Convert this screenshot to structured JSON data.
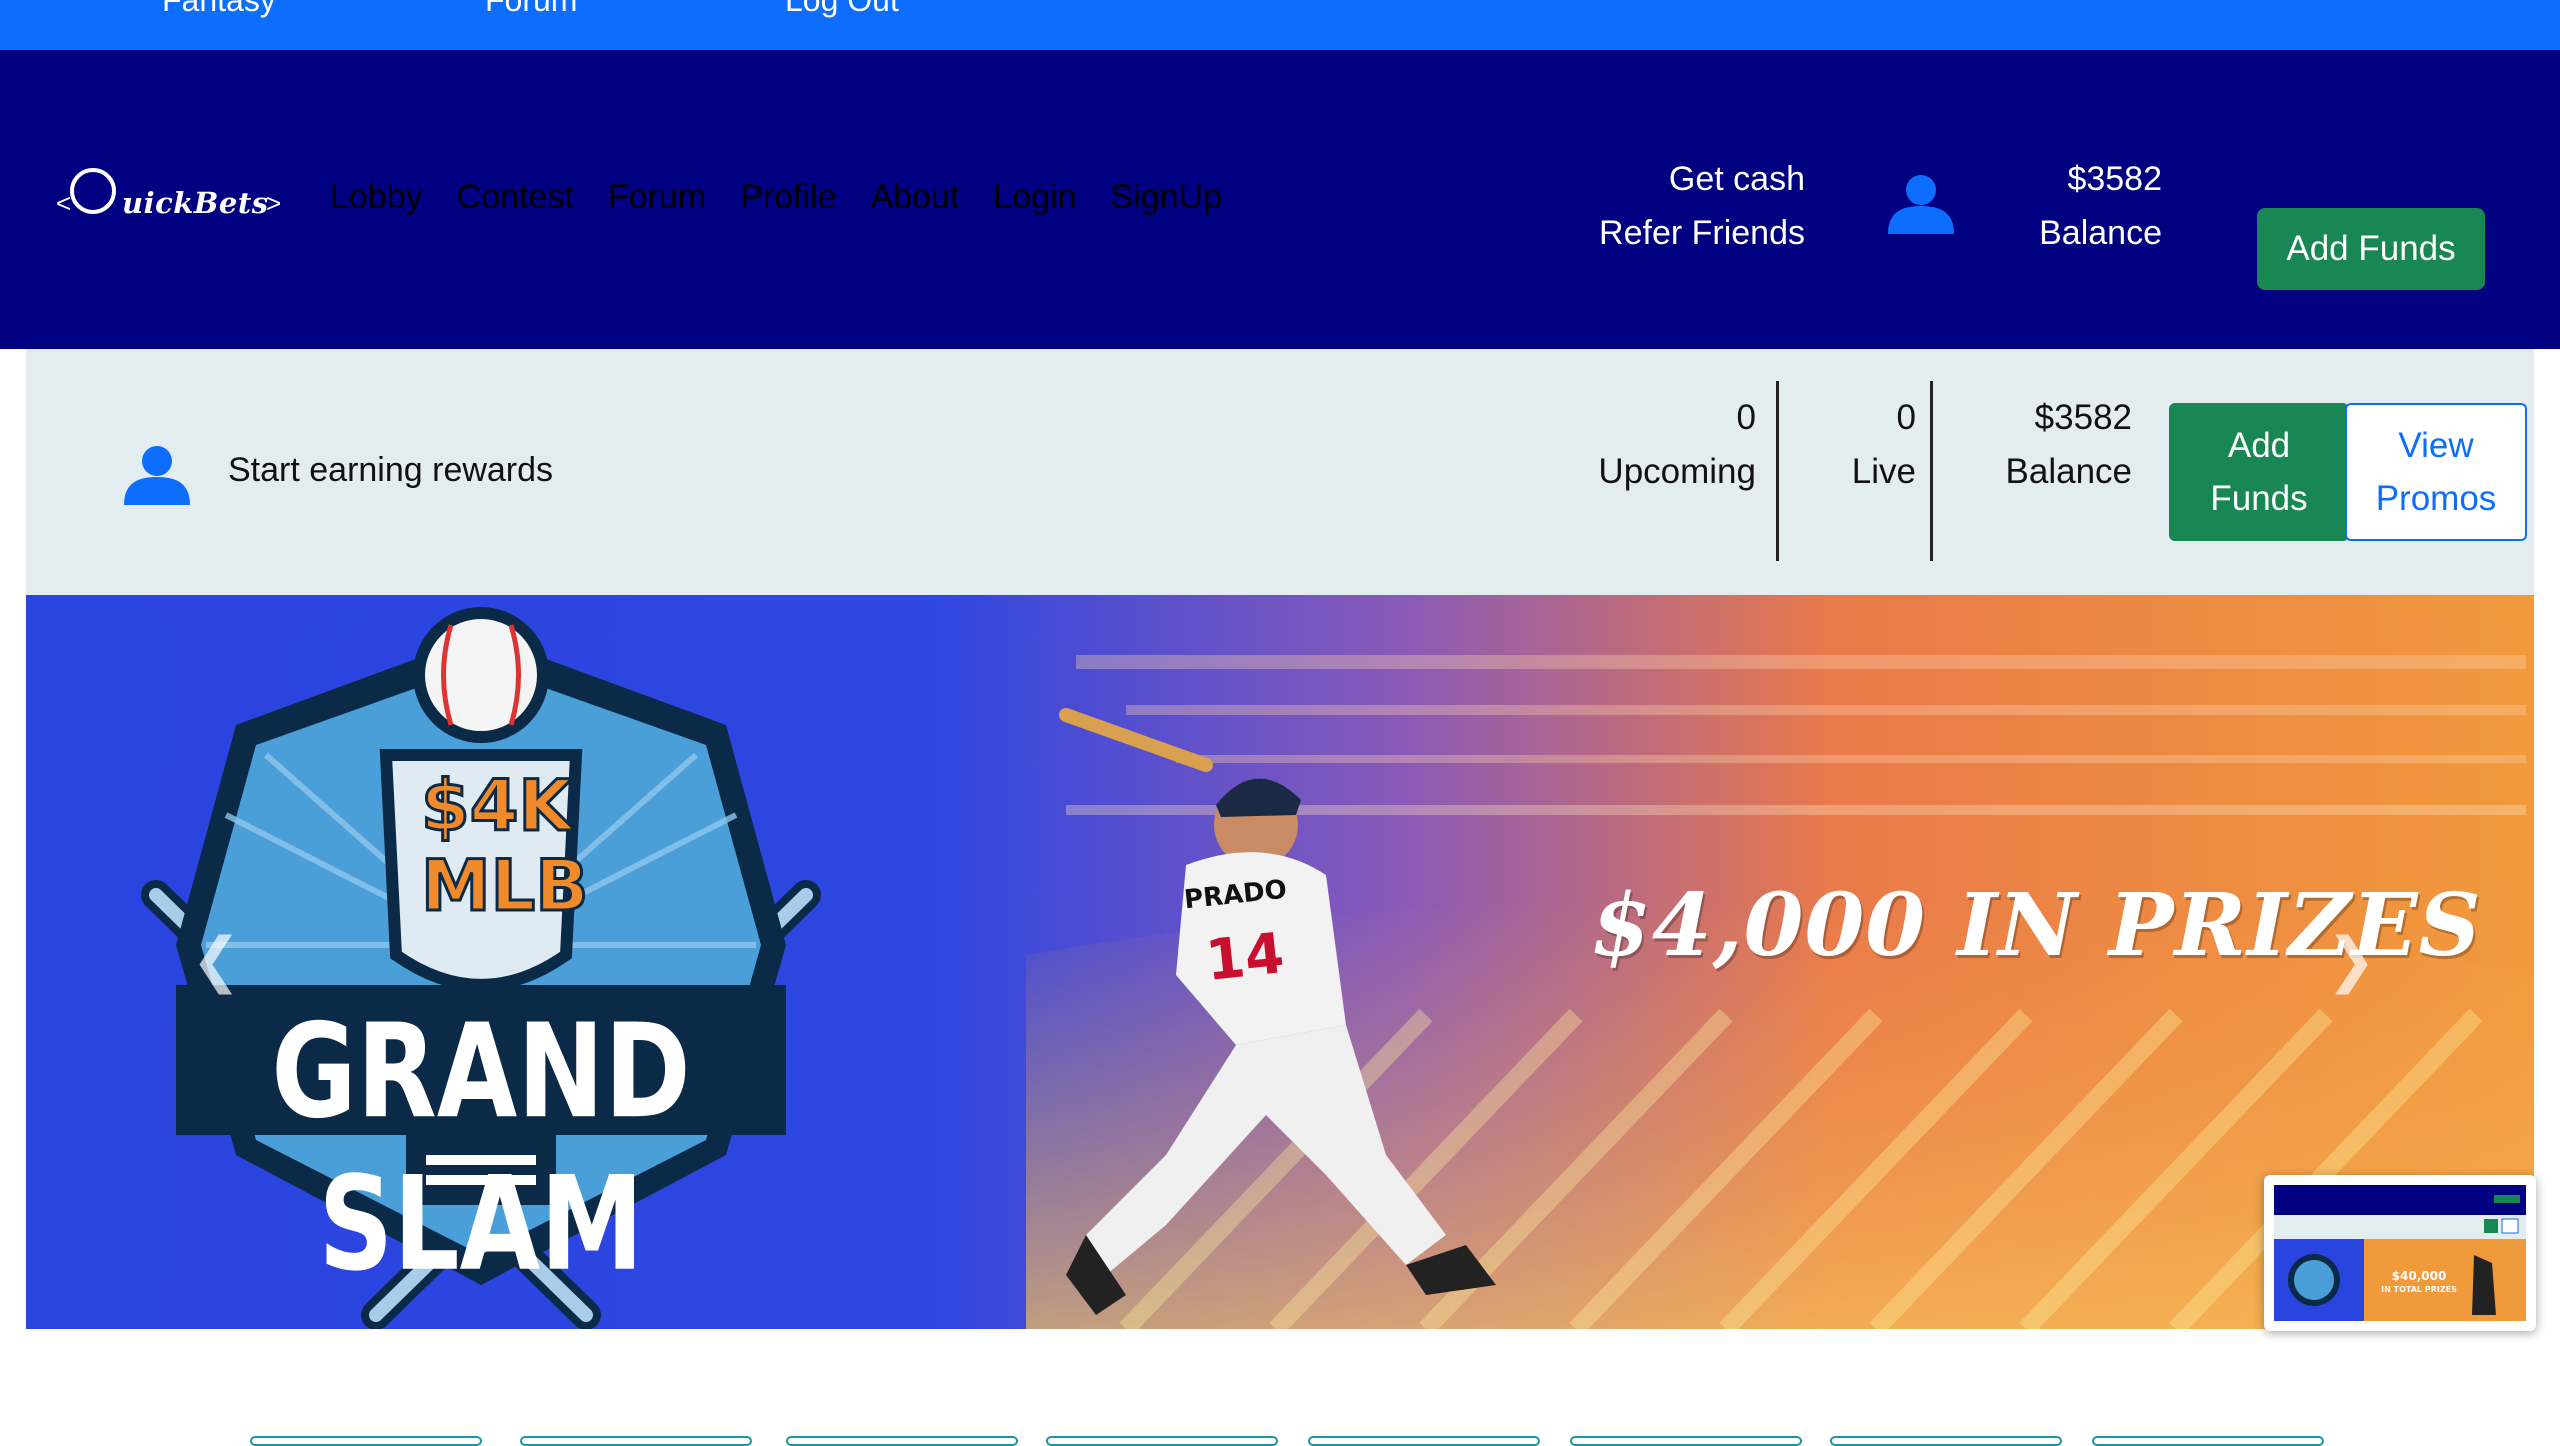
{
  "top_strip": {
    "items": [
      "Fantasy",
      "Forum",
      "Log Out"
    ]
  },
  "brand": {
    "logo_text": "uickBets"
  },
  "nav": {
    "links": [
      "Lobby",
      "Contest",
      "Forum",
      "Profile",
      "About",
      "Login",
      "SignUp"
    ]
  },
  "header": {
    "get_cash": "Get cash",
    "refer_friends": "Refer Friends",
    "balance_amount": "$3582",
    "balance_label": "Balance",
    "add_funds": "Add Funds"
  },
  "stats_bar": {
    "earn_text": "Start earning rewards",
    "upcoming_count": "0",
    "upcoming_label": "Upcoming",
    "live_count": "0",
    "live_label": "Live",
    "balance_amount": "$3582",
    "balance_label": "Balance",
    "add_funds_line1": "Add",
    "add_funds_line2": "Funds",
    "view_promos_line1": "View",
    "view_promos_line2": "Promos"
  },
  "carousel": {
    "badge_top": "$4K",
    "badge_mid": "MLB",
    "badge_main": "GRAND SLAM",
    "player_name": "PRADO",
    "player_number": "14",
    "headline": "$4,000 IN PRIZES",
    "thumb_headline": "$40,000",
    "thumb_sub": "IN TOTAL PRIZES",
    "slide_count": 2
  },
  "tabs": {
    "count": 8
  },
  "colors": {
    "top_strip": "#0d6efd",
    "navbar": "#000080",
    "success": "#198754",
    "stats_bg": "#e3ecee",
    "primary": "#0d6efd"
  }
}
